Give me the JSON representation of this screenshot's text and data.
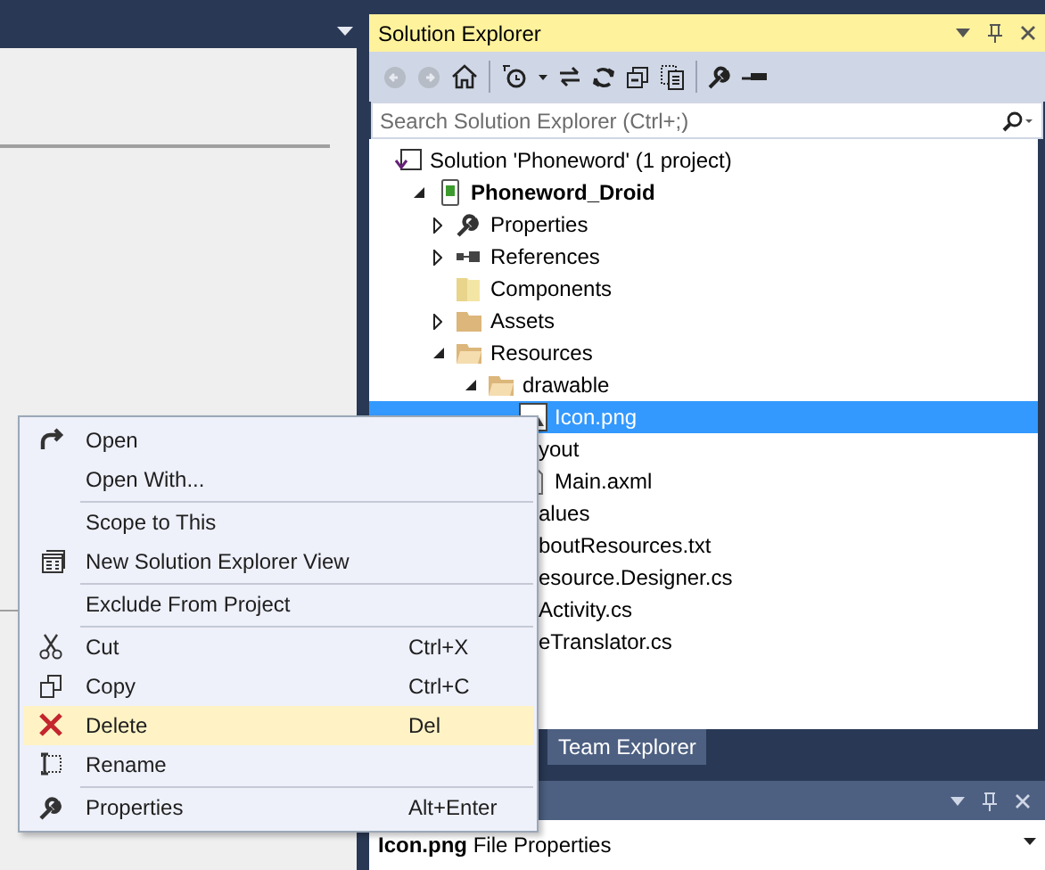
{
  "solution_explorer": {
    "title": "Solution Explorer",
    "search": {
      "placeholder": "Search Solution Explorer (Ctrl+;)"
    },
    "tree": [
      {
        "label": "Solution 'Phoneword' (1 project)",
        "kind": "solution",
        "selected": false,
        "children": [
          {
            "label": "Phoneword_Droid",
            "kind": "project",
            "bold": true,
            "expanded": true,
            "selected": false,
            "children": [
              {
                "label": "Properties",
                "kind": "properties",
                "expanded": false,
                "selected": false
              },
              {
                "label": "References",
                "kind": "references",
                "expanded": false,
                "selected": false
              },
              {
                "label": "Components",
                "kind": "component",
                "selected": false
              },
              {
                "label": "Assets",
                "kind": "folder",
                "expanded": false,
                "selected": false
              },
              {
                "label": "Resources",
                "kind": "folder",
                "expanded": true,
                "selected": false,
                "children": [
                  {
                    "label": "drawable",
                    "kind": "folder",
                    "expanded": true,
                    "selected": false,
                    "children": [
                      {
                        "label": "Icon.png",
                        "kind": "image",
                        "selected": true
                      }
                    ]
                  },
                  {
                    "label": "yout",
                    "clipped": true,
                    "selected": false,
                    "children": [
                      {
                        "label": "Main.axml",
                        "kind": "file",
                        "selected": false
                      }
                    ]
                  },
                  {
                    "label": "alues",
                    "clipped": true,
                    "selected": false
                  }
                ]
              },
              {
                "label": "boutResources.txt",
                "clipped": true,
                "selected": false
              },
              {
                "label": "esource.Designer.cs",
                "clipped": true,
                "selected": false
              },
              {
                "label": "Activity.cs",
                "clipped": true,
                "selected": false
              },
              {
                "label": "eTranslator.cs",
                "clipped": true,
                "selected": false
              }
            ]
          }
        ]
      }
    ],
    "tabs": [
      {
        "label": "Team Explorer",
        "selected": false
      }
    ]
  },
  "properties_panel": {
    "subject": "**Icon.png** File Properties"
  },
  "context_menu": [
    {
      "kind": "item",
      "label": "Open",
      "selected": false
    },
    {
      "kind": "item",
      "label": "Open With...",
      "selected": false
    },
    {
      "kind": "separator"
    },
    {
      "kind": "item",
      "label": "Scope to This",
      "selected": false
    },
    {
      "kind": "item",
      "label": "New Solution Explorer View",
      "selected": false
    },
    {
      "kind": "separator"
    },
    {
      "kind": "item",
      "label": "Exclude From Project",
      "selected": false
    },
    {
      "kind": "separator"
    },
    {
      "kind": "item",
      "label": "Cut",
      "shortcut": "Ctrl+X",
      "selected": false
    },
    {
      "kind": "item",
      "label": "Copy",
      "shortcut": "Ctrl+C",
      "selected": false
    },
    {
      "kind": "item",
      "label": "Delete",
      "shortcut": "Del",
      "selected": true
    },
    {
      "kind": "item",
      "label": "Rename",
      "selected": false
    },
    {
      "kind": "separator"
    },
    {
      "kind": "item",
      "label": "Properties",
      "shortcut": "Alt+Enter",
      "selected": false
    }
  ]
}
